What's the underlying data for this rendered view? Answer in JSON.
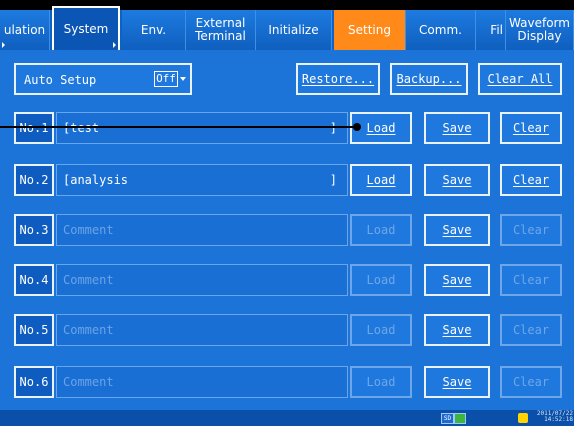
{
  "tabs": [
    {
      "label": "ulation"
    },
    {
      "label": "System"
    },
    {
      "label": "Env."
    },
    {
      "label": "External\nTerminal"
    },
    {
      "label": "Initialize"
    },
    {
      "label": "Setting"
    },
    {
      "label": "Comm."
    },
    {
      "label": "Fil"
    },
    {
      "label": "Waveform\nDisplay"
    }
  ],
  "toolbar": {
    "auto_setup_label": "Auto Setup",
    "auto_setup_value": "Off",
    "restore_label": "Restore...",
    "backup_label": "Backup...",
    "clear_all_label": "Clear All"
  },
  "rows": [
    {
      "no": "No.1",
      "comment": "[test",
      "bracket": "]",
      "comment_is_placeholder": false,
      "load": "Load",
      "save": "Save",
      "clear": "Clear",
      "load_enabled": true,
      "clear_enabled": true
    },
    {
      "no": "No.2",
      "comment": "[analysis",
      "bracket": "]",
      "comment_is_placeholder": false,
      "load": "Load",
      "save": "Save",
      "clear": "Clear",
      "load_enabled": true,
      "clear_enabled": true
    },
    {
      "no": "No.3",
      "comment": "Comment",
      "bracket": "",
      "comment_is_placeholder": true,
      "load": "Load",
      "save": "Save",
      "clear": "Clear",
      "load_enabled": false,
      "clear_enabled": false
    },
    {
      "no": "No.4",
      "comment": "Comment",
      "bracket": "",
      "comment_is_placeholder": true,
      "load": "Load",
      "save": "Save",
      "clear": "Clear",
      "load_enabled": false,
      "clear_enabled": false
    },
    {
      "no": "No.5",
      "comment": "Comment",
      "bracket": "",
      "comment_is_placeholder": true,
      "load": "Load",
      "save": "Save",
      "clear": "Clear",
      "load_enabled": false,
      "clear_enabled": false
    },
    {
      "no": "No.6",
      "comment": "Comment",
      "bracket": "",
      "comment_is_placeholder": true,
      "load": "Load",
      "save": "Save",
      "clear": "Clear",
      "load_enabled": false,
      "clear_enabled": false
    }
  ],
  "status": {
    "sd_label": "SD",
    "datetime": "2011/07/22\n14:52:18"
  },
  "colors": {
    "accent": "#ff8a1a",
    "background": "#1c74d8"
  }
}
